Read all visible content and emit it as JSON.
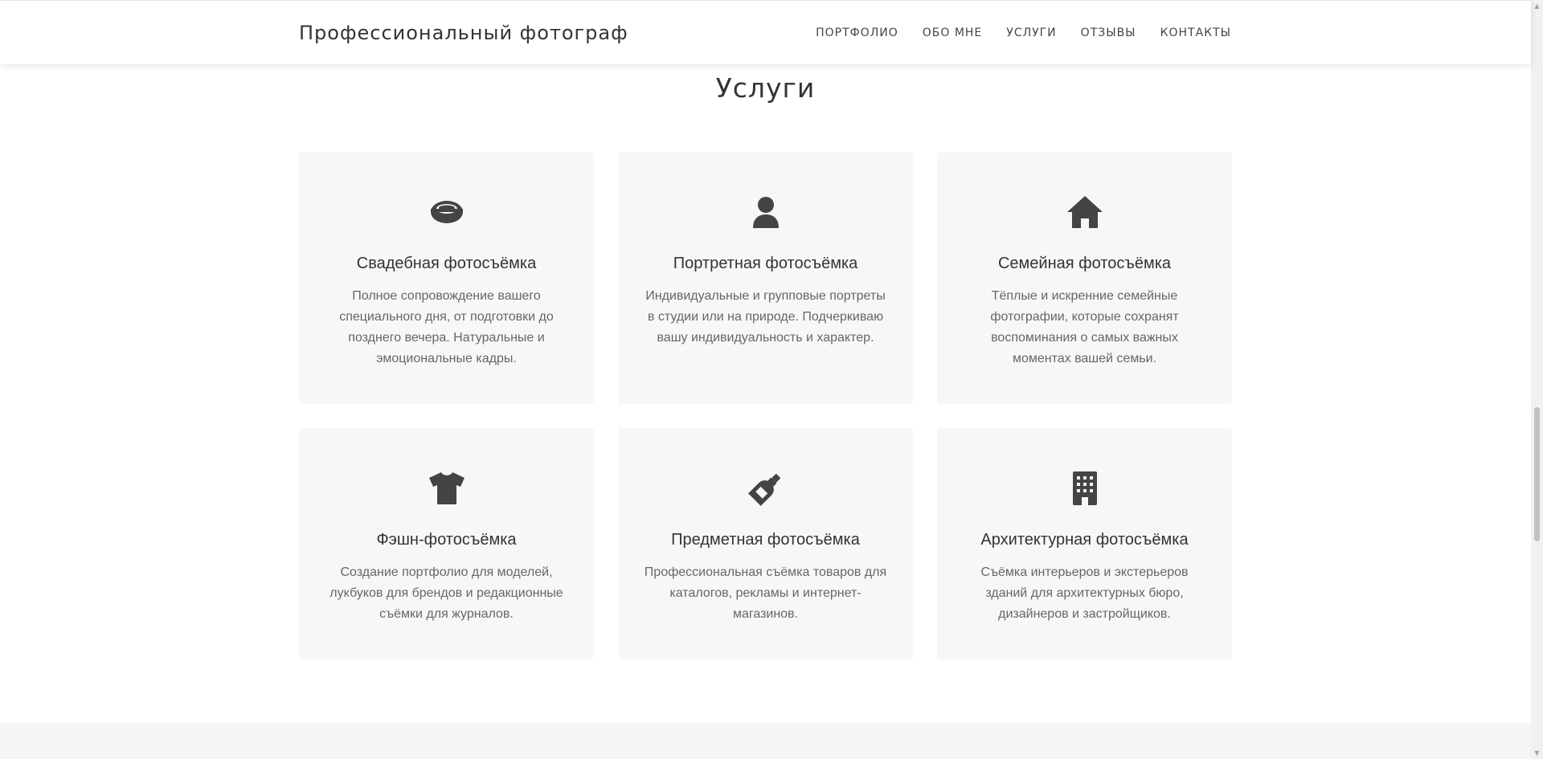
{
  "header": {
    "logo": "Профессиональный фотограф",
    "nav": [
      {
        "label": "ПОРТФОЛИО"
      },
      {
        "label": "ОБО МНЕ"
      },
      {
        "label": "УСЛУГИ"
      },
      {
        "label": "ОТЗЫВЫ"
      },
      {
        "label": "КОНТАКТЫ"
      }
    ]
  },
  "services": {
    "title": "Услуги",
    "cards": [
      {
        "icon": "ring-icon",
        "title": "Свадебная фотосъёмка",
        "text": "Полное сопровождение вашего специального дня, от подготовки до позднего вечера. Натуральные и эмоциональные кадры."
      },
      {
        "icon": "user-icon",
        "title": "Портретная фотосъёмка",
        "text": "Индивидуальные и групповые портреты в студии или на природе. Подчеркиваю вашу индивидуальность и характер."
      },
      {
        "icon": "home-icon",
        "title": "Семейная фотосъёмка",
        "text": "Тёплые и искренние семейные фотографии, которые сохранят воспоминания о самых важных моментах вашей семьи."
      },
      {
        "icon": "tshirt-icon",
        "title": "Фэшн-фотосъёмка",
        "text": "Создание портфолио для моделей, лукбуков для брендов и редакционные съёмки для журналов."
      },
      {
        "icon": "bottle-icon",
        "title": "Предметная фотосъёмка",
        "text": "Профессиональная съёмка товаров для каталогов, рекламы и интернет-магазинов."
      },
      {
        "icon": "building-icon",
        "title": "Архитектурная фотосъёмка",
        "text": "Съёмка интерьеров и экстерьеров зданий для архитектурных бюро, дизайнеров и застройщиков."
      }
    ]
  },
  "colors": {
    "text": "#333333",
    "muted_text": "#666666",
    "icon": "#444444",
    "card_bg": "#f7f7f7"
  },
  "scrollbar": {
    "position_fraction": 0.62
  }
}
